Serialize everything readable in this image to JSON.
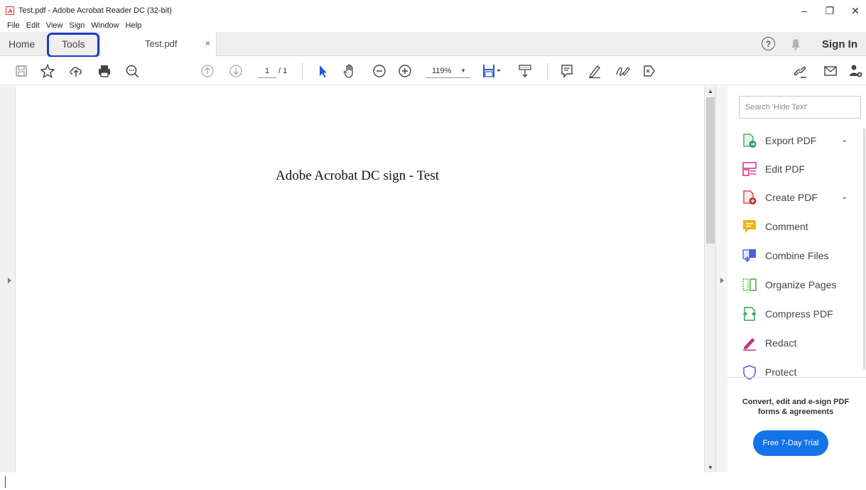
{
  "window": {
    "title": "Test.pdf - Adobe Acrobat Reader DC (32-bit)",
    "min_glyph": "–",
    "max_glyph": "❐",
    "close_glyph": "✕"
  },
  "menu": [
    "File",
    "Edit",
    "View",
    "Sign",
    "Window",
    "Help"
  ],
  "tabs": {
    "home": "Home",
    "tools": "Tools",
    "document": "Test.pdf",
    "close_glyph": "×"
  },
  "header_right": {
    "help_glyph": "?",
    "signin": "Sign In"
  },
  "toolbar": {
    "page_current": "1",
    "page_total": "/ 1",
    "zoom": "119%",
    "zoom_caret": "▼"
  },
  "document": {
    "text": "Adobe Acrobat DC sign - Test"
  },
  "scroll": {
    "up_glyph": "▲",
    "down_glyph": "▼"
  },
  "rightpane": {
    "search_placeholder": "Search 'Hide Text'",
    "tools": [
      {
        "label": "Export PDF",
        "icon": "export-pdf-icon",
        "has_chevron": true
      },
      {
        "label": "Edit PDF",
        "icon": "edit-pdf-icon",
        "has_chevron": false
      },
      {
        "label": "Create PDF",
        "icon": "create-pdf-icon",
        "has_chevron": true
      },
      {
        "label": "Comment",
        "icon": "comment-icon",
        "has_chevron": false
      },
      {
        "label": "Combine Files",
        "icon": "combine-files-icon",
        "has_chevron": false
      },
      {
        "label": "Organize Pages",
        "icon": "organize-pages-icon",
        "has_chevron": false
      },
      {
        "label": "Compress PDF",
        "icon": "compress-pdf-icon",
        "has_chevron": false
      },
      {
        "label": "Redact",
        "icon": "redact-icon",
        "has_chevron": false
      },
      {
        "label": "Protect",
        "icon": "protect-icon",
        "has_chevron": false
      }
    ],
    "chevron_glyph": "⌄",
    "promo_text": "Convert, edit and e-sign PDF forms & agreements",
    "trial_button": "Free 7-Day Trial"
  },
  "colors": {
    "accent_blue": "#1473e6",
    "highlight_box": "#1a3fbf",
    "acrobat_red": "#d0302f"
  }
}
